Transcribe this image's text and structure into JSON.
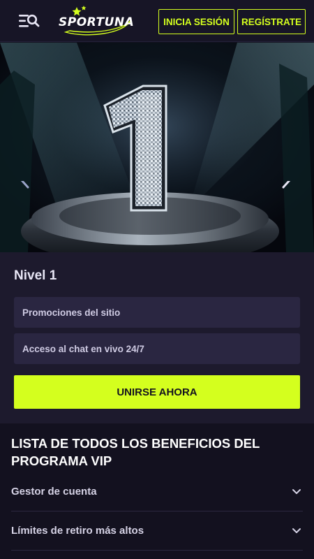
{
  "header": {
    "logo_text": "SPORTUNA",
    "login_label": "INICIA SESIÓN",
    "register_label": "REGÍSTRATE",
    "accent_color": "#d4ff1e"
  },
  "hero": {
    "level_number": "1",
    "prev_icon": "chevron-left-icon",
    "next_icon": "chevron-right-icon"
  },
  "level": {
    "title": "Nivel 1",
    "benefits": [
      "Promociones del sitio",
      "Acceso al chat en vivo 24/7"
    ],
    "join_label": "UNIRSE AHORA"
  },
  "vip_list": {
    "title": "LISTA DE TODOS LOS BENEFICIOS DEL PROGRAMA VIP",
    "items": [
      "Gestor de cuenta",
      "Límites de retiro más altos"
    ]
  }
}
